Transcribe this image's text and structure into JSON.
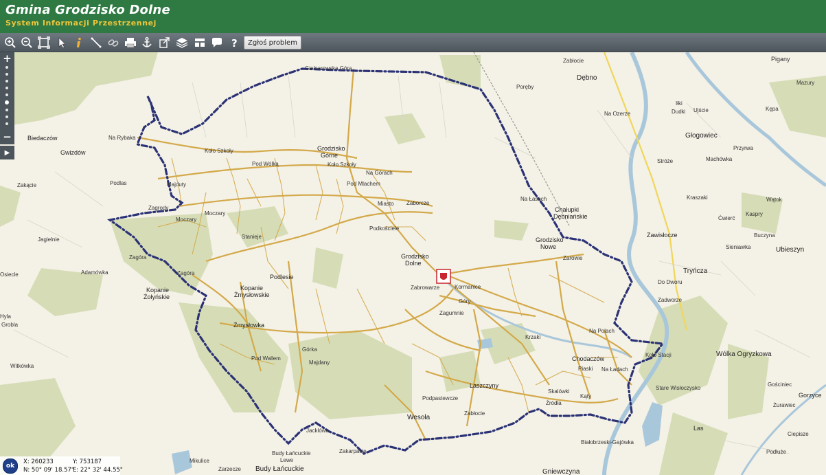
{
  "header": {
    "title": "Gmina Grodzisko Dolne",
    "subtitle": "System Informacji Przestrzennej"
  },
  "toolbar": {
    "tools": [
      {
        "name": "zoom-in",
        "icon": "zoom-in-icon"
      },
      {
        "name": "zoom-out",
        "icon": "zoom-out-icon"
      },
      {
        "name": "zoom-extent",
        "icon": "zoom-extent-icon"
      },
      {
        "name": "select",
        "icon": "pointer-icon"
      },
      {
        "name": "info",
        "icon": "info-icon"
      },
      {
        "name": "measure-distance",
        "icon": "ruler-icon"
      },
      {
        "name": "link",
        "icon": "link-icon"
      },
      {
        "name": "print",
        "icon": "printer-icon"
      },
      {
        "name": "anchor",
        "icon": "anchor-icon"
      },
      {
        "name": "export",
        "icon": "export-icon"
      },
      {
        "name": "layers",
        "icon": "layers-icon"
      },
      {
        "name": "layout",
        "icon": "layout-icon"
      },
      {
        "name": "comment",
        "icon": "speech-bubble-icon"
      },
      {
        "name": "help",
        "icon": "help-icon"
      }
    ],
    "report_button": "Zgłoś problem"
  },
  "zoom": {
    "plus": "+",
    "minus": "−",
    "expand": "▶"
  },
  "coords": {
    "ok": "ok",
    "x": "X: 260233",
    "y": "Y: 753187",
    "n": "N: 50° 09' 18.57\"",
    "e": "E: 22° 32' 44.55\""
  },
  "colors": {
    "header": "#2f7a43",
    "subtitle": "#f0c63b",
    "boundary": "#2b3275",
    "roads": "#d3a94a",
    "forest": "#d6ddb6",
    "water": "#a9c7db"
  },
  "places": {
    "gielnia": "Gielnarowska Góra",
    "debno": "Dębno",
    "pigany": "Pigany",
    "zablocie_n": "Zabłocie",
    "poreby": "Poręby",
    "mazury": "Mazury",
    "ilki": "Iłki",
    "dudki": "Dudki",
    "ujscie": "Ujście",
    "kepa": "Kępa",
    "na_ozerze": "Na Ozerze",
    "glogowiec": "Głogowiec",
    "przyrwa": "Przyrwa",
    "machowka": "Machówka",
    "stroze": "Stróże",
    "biedaczow": "Biedaczów",
    "gwizdow": "Gwizdów",
    "na_rybaka": "Na Rybaka",
    "kolo_szkoly": "Koło Szkoły",
    "grodzisko_gorne_1": "Grodzisko",
    "grodzisko_gorne_2": "Górne",
    "pod_wolka": "Pod Wólką",
    "kato_szkoly": "Koło Szkoły",
    "na_gorach": "Na Górach",
    "pod_mlachem": "Pod Mlachem",
    "zakacie": "Zakącie",
    "podlas": "Podlas",
    "majduty": "Majduty",
    "zagrody": "Zagrody",
    "moczary_1": "Moczary",
    "moczary_2": "Moczary",
    "miasto": "Miasto",
    "zaborcze": "Zaborcze",
    "na_lasach": "Na Łasach",
    "chalupki_1": "Chałupki",
    "chalupki_2": "Dębniańskie",
    "watok": "Wątok",
    "kraszaki": "Kraszaki",
    "cwierc": "Ćwierć",
    "kaspry": "Kaspry",
    "jagielnie": "Jagielnie",
    "stanieje": "Stanieje",
    "podkoscielie": "Podkościele",
    "grodzisko_nowe_1": "Grodzisko",
    "grodzisko_nowe_2": "Nowe",
    "zawisloczce": "Zawisłocze",
    "buczyna": "Buczyna",
    "sieniawka": "Sieniawka",
    "ubieszyn": "Ubieszyn",
    "zagora_1": "Zagóra",
    "zagora_2": "Zagóra",
    "adamowka": "Adamówka",
    "grodzisko_dolne_1": "Grodzisko",
    "grodzisko_dolne_2": "Dolne",
    "zarowie": "Zarowie",
    "trynca": "Tryńcza",
    "podlesie": "Podlesie",
    "do_dworu": "Do Dworu",
    "osiecle": "Osiecle",
    "kopanie_1": "Kopanie",
    "kopanie_2": "Żołyńskie",
    "kopanie_z_1": "Kopanie",
    "kopanie_z_2": "Żmysłowskie",
    "zabrowarze": "Zabrowarze",
    "kormanice": "Kormanice",
    "zadworze": "Zadworze",
    "gory": "Góry",
    "zagumnie": "Zagumnie",
    "zmyslowka": "Żmysłowka",
    "krzaki": "Krzaki",
    "na_polach": "Na Polach",
    "hyla": "Hyla",
    "grobla": "Grobla",
    "gorka": "Górka",
    "pod_wallem": "Pod Wallem",
    "majdany": "Majdany",
    "chodaczow": "Chodaczów",
    "piaski": "Piaski",
    "na_ladach": "Na Ładach",
    "kolo_stacji": "Koło Stacji",
    "wolka_ogryzkowa": "Wólka Ogryzkowa",
    "witkowka": "Witkówka",
    "laszczyny": "Laszczyny",
    "skalowki": "Skalówki",
    "stare_wisloczysko": "Stare Wisłoczysko",
    "podpastewcze": "Podpastewcze",
    "zrodla": "Źródła",
    "katy": "Kąty",
    "goscinec": "Gościniec",
    "gorzyce": "Gorzyce",
    "wesola": "Wesoła",
    "zablocie_s": "Zabłocie",
    "zurawiec": "Żurawiec",
    "las": "Las",
    "ciepisze": "Ciepisze",
    "jacklowa": "Jacklówa",
    "bialobrzeski": "Białobrzeski-Gajówka",
    "podluze": "Podłuże",
    "budy_lewe_1": "Budy Łańcuckie",
    "budy_lewe_2": "Lewe",
    "zakarpacie": "Zakarpacie",
    "mikulice": "Mikulice",
    "zarzecze": "Zarzecze",
    "budy_lancuckie": "Budy Łańcuckie",
    "gniewczyna": "Gniewczyna"
  }
}
